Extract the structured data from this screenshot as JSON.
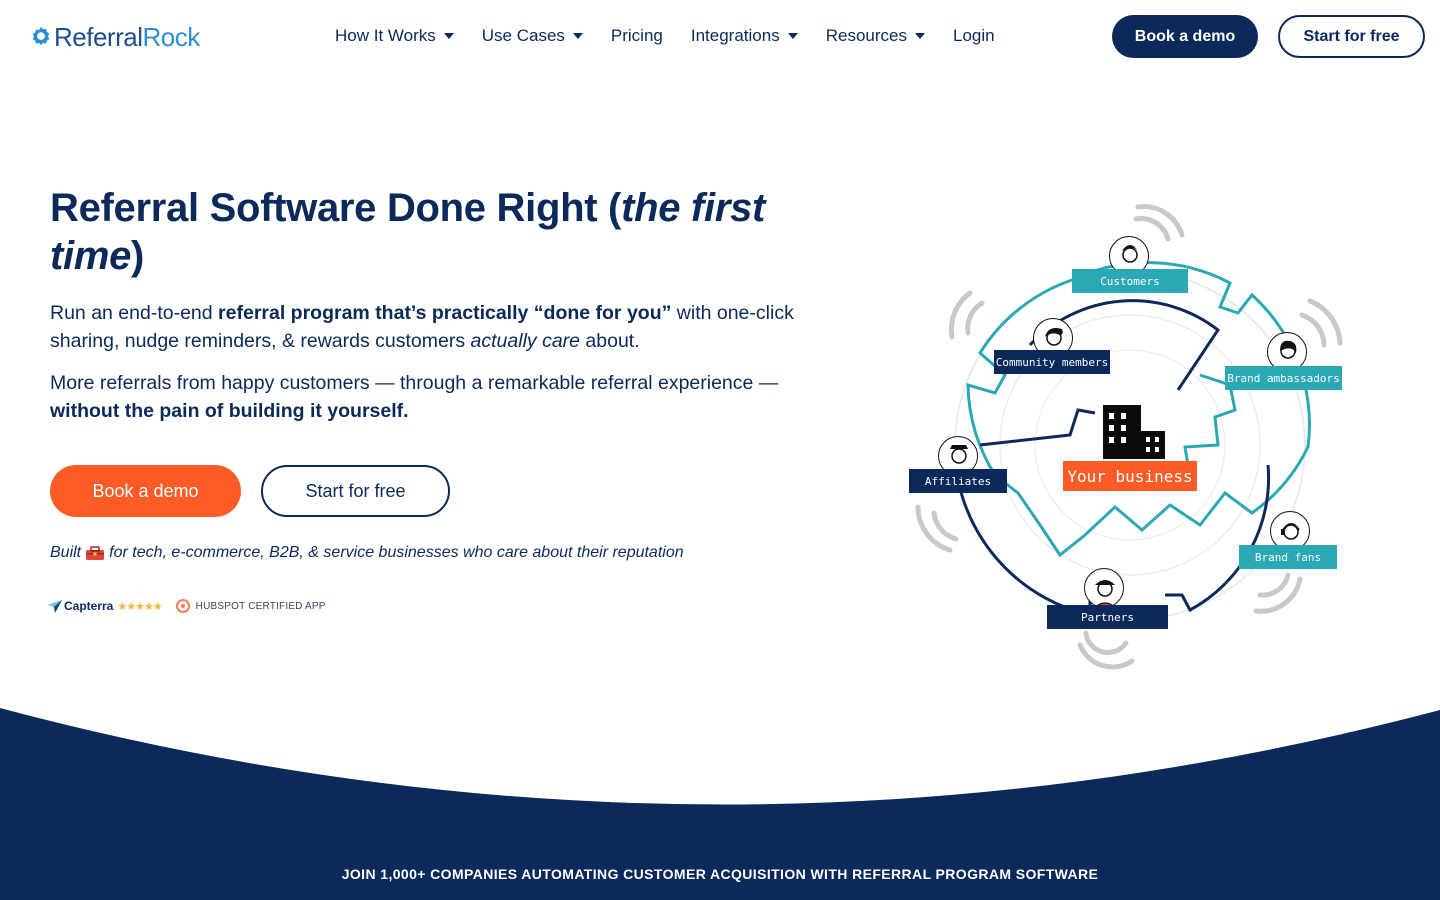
{
  "brand": {
    "logo_part1": "Referral",
    "logo_part2": "Rock"
  },
  "nav": {
    "items": [
      {
        "label": "How It Works",
        "dropdown": true
      },
      {
        "label": "Use Cases",
        "dropdown": true
      },
      {
        "label": "Pricing",
        "dropdown": false
      },
      {
        "label": "Integrations",
        "dropdown": true
      },
      {
        "label": "Resources",
        "dropdown": true
      },
      {
        "label": "Login",
        "dropdown": false
      }
    ],
    "book_demo": "Book a demo",
    "start_free": "Start for free"
  },
  "hero": {
    "title_main": "Referral Software Done Right (",
    "title_em": "the first time",
    "title_end": ")",
    "p1_a": "Run an end-to-end ",
    "p1_b": "referral program that’s practically “done for you”",
    "p1_c": " with one-click sharing, nudge reminders, & rewards customers ",
    "p1_d": "actually care",
    "p1_e": " about.",
    "p2_a": "More referrals from happy customers — through a remarkable referral experience — ",
    "p2_b": "without the pain of building it yourself.",
    "book_demo": "Book a demo",
    "start_free": "Start for free",
    "built_a": "Built",
    "built_b": "for tech, e-commerce, B2B, & service businesses who care about their reputation",
    "capterra": "Capterra",
    "capterra_stars": "★★★★★",
    "hubspot": "HUBSPOT CERTIFIED APP"
  },
  "diagram": {
    "center": "Your business",
    "labels": {
      "customers": "Customers",
      "community": "Community members",
      "ambassadors": "Brand ambassadors",
      "affiliates": "Affiliates",
      "fans": "Brand fans",
      "partners": "Partners"
    }
  },
  "band": {
    "join": "JOIN 1,000+ COMPANIES AUTOMATING CUSTOMER ACQUISITION WITH REFERRAL PROGRAM SOFTWARE"
  },
  "colors": {
    "navy": "#0b2a5b",
    "orange": "#ff5b26",
    "teal": "#2aa8b6"
  }
}
